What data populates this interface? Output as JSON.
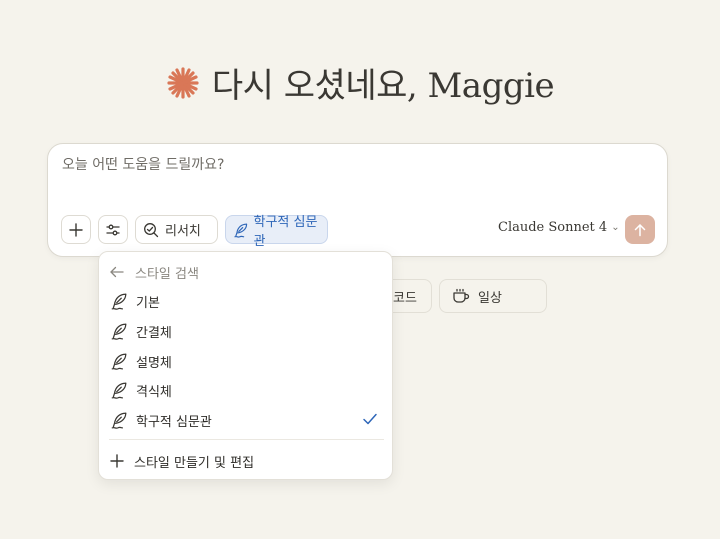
{
  "greeting": {
    "text": "다시 오셨네요, Maggie",
    "icon": "claude-spark-icon",
    "icon_color": "#d97757"
  },
  "prompt": {
    "placeholder": "오늘 어떤 도움을 드릴까요?",
    "value": ""
  },
  "toolbar": {
    "add_icon": "plus-icon",
    "tools_icon": "sliders-icon",
    "research_label": "리서치",
    "style_label": "학구적 심문관",
    "model_label": "Claude Sonnet 4",
    "send_icon": "arrow-up-icon",
    "send_color": "#dcb3a1"
  },
  "chips": [
    {
      "label": "코드"
    },
    {
      "label": "일상",
      "icon": "coffee-cup-icon"
    }
  ],
  "style_menu": {
    "header": "스타일 검색",
    "items": [
      {
        "label": "기본",
        "selected": false
      },
      {
        "label": "간결체",
        "selected": false
      },
      {
        "label": "설명체",
        "selected": false
      },
      {
        "label": "격식체",
        "selected": false
      },
      {
        "label": "학구적 심문관",
        "selected": true
      }
    ],
    "create_label": "스타일 만들기 및 편집",
    "check_color": "#2e66b8"
  }
}
